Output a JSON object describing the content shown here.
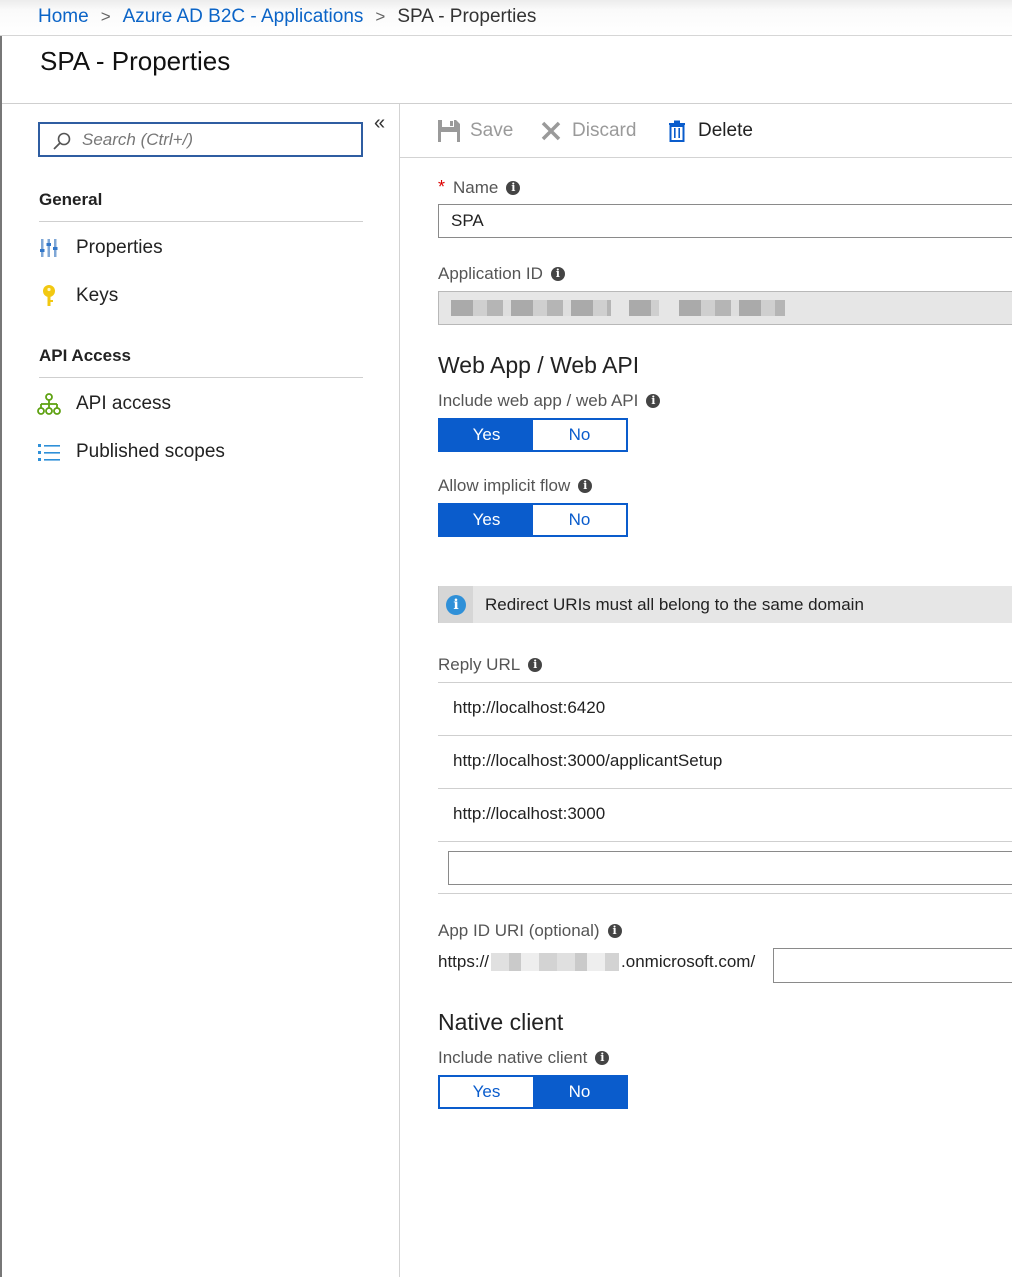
{
  "breadcrumb": {
    "home": "Home",
    "parent": "Azure AD B2C - Applications",
    "current": "SPA - Properties",
    "separator": ">"
  },
  "page": {
    "title": "SPA - Properties"
  },
  "sidebar": {
    "search_placeholder": "Search (Ctrl+/)",
    "collapse_glyph": "«",
    "sections": [
      {
        "heading": "General",
        "items": [
          {
            "label": "Properties",
            "icon": "properties-icon"
          },
          {
            "label": "Keys",
            "icon": "key-icon"
          }
        ]
      },
      {
        "heading": "API Access",
        "items": [
          {
            "label": "API access",
            "icon": "api-access-icon"
          },
          {
            "label": "Published scopes",
            "icon": "list-icon"
          }
        ]
      }
    ]
  },
  "toolbar": {
    "save_label": "Save",
    "discard_label": "Discard",
    "delete_label": "Delete"
  },
  "form": {
    "name_label": "Name",
    "name_required_mark": "*",
    "name_value": "SPA",
    "app_id_label": "Application ID",
    "web_section_title": "Web App / Web API",
    "include_web_label": "Include web app / web API",
    "include_web_yes": "Yes",
    "include_web_no": "No",
    "include_web_selected": "Yes",
    "implicit_label": "Allow implicit flow",
    "implicit_yes": "Yes",
    "implicit_no": "No",
    "implicit_selected": "Yes",
    "info_message": "Redirect URIs must all belong to the same domain",
    "reply_url_label": "Reply URL",
    "reply_urls": [
      "http://localhost:6420",
      "http://localhost:3000/applicantSetup",
      "http://localhost:3000"
    ],
    "app_id_uri_label": "App ID URI (optional)",
    "app_id_uri_prefix": "https://",
    "app_id_uri_suffix": ".onmicrosoft.com/",
    "native_section_title": "Native client",
    "include_native_label": "Include native client",
    "include_native_yes": "Yes",
    "include_native_no": "No",
    "include_native_selected": "No"
  },
  "colors": {
    "accent": "#0a5ccc",
    "link": "#0b64c7",
    "required": "#dd0000",
    "info": "#2f90d8"
  }
}
